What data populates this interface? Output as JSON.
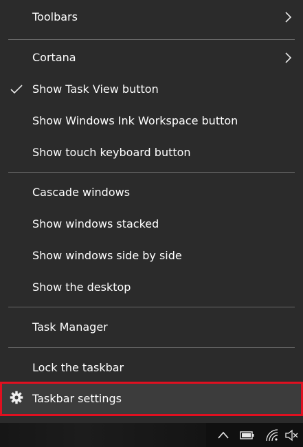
{
  "menu": {
    "items": [
      {
        "label": "Toolbars",
        "submenu": true
      },
      {
        "label": "Cortana",
        "submenu": true
      },
      {
        "label": "Show Task View button",
        "checked": true
      },
      {
        "label": "Show Windows Ink Workspace button"
      },
      {
        "label": "Show touch keyboard button"
      },
      {
        "label": "Cascade windows"
      },
      {
        "label": "Show windows stacked"
      },
      {
        "label": "Show windows side by side"
      },
      {
        "label": "Show the desktop"
      },
      {
        "label": "Task Manager"
      },
      {
        "label": "Lock the taskbar"
      },
      {
        "label": "Taskbar settings",
        "icon": "gear-icon",
        "highlighted": true
      }
    ]
  },
  "taskbar": {
    "tray_icons": [
      "chevron-up-icon",
      "battery-icon",
      "wifi-icon",
      "volume-muted-icon"
    ]
  },
  "colors": {
    "menu_bg": "#2b2b2b",
    "separator": "#6a6a6a",
    "highlight_border": "#e01020",
    "highlight_bg": "#3c3c3c",
    "text": "#ffffff"
  }
}
